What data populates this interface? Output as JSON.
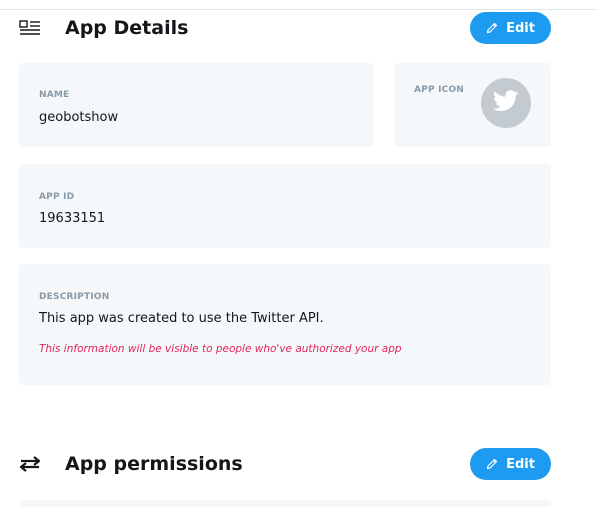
{
  "app_details": {
    "title": "App Details",
    "edit_label": "Edit",
    "name": {
      "label": "NAME",
      "value": "geobotshow"
    },
    "app_icon": {
      "label": "APP ICON",
      "icon": "twitter-bird-icon"
    },
    "app_id": {
      "label": "APP ID",
      "value": "19633151"
    },
    "description": {
      "label": "DESCRIPTION",
      "value": "This app was created to use the Twitter API.",
      "note": "This information will be visible to people who've authorized your app"
    }
  },
  "app_permissions": {
    "title": "App permissions",
    "edit_label": "Edit"
  },
  "colors": {
    "accent": "#1d9bf0",
    "card_background": "#f5f8fa",
    "label": "#8899a6",
    "note": "#e0245e",
    "avatar": "#c4cbd0"
  }
}
